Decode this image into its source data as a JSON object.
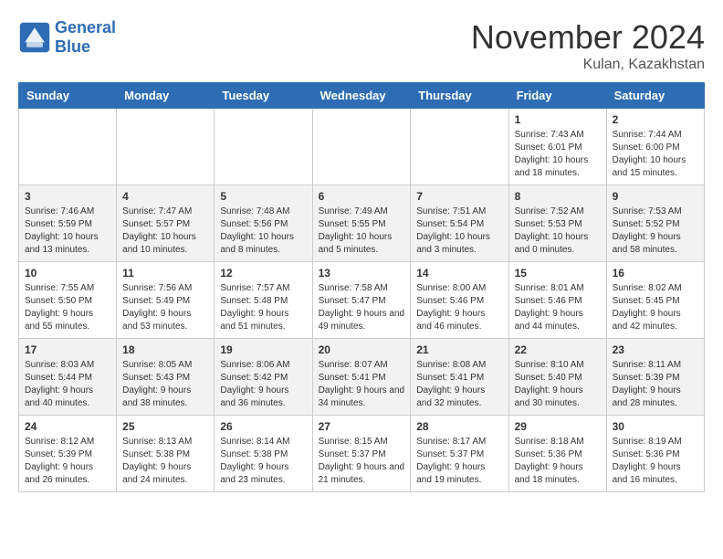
{
  "header": {
    "logo_line1": "General",
    "logo_line2": "Blue",
    "month_title": "November 2024",
    "location": "Kulan, Kazakhstan"
  },
  "weekdays": [
    "Sunday",
    "Monday",
    "Tuesday",
    "Wednesday",
    "Thursday",
    "Friday",
    "Saturday"
  ],
  "days": [
    {
      "num": "",
      "info": ""
    },
    {
      "num": "",
      "info": ""
    },
    {
      "num": "",
      "info": ""
    },
    {
      "num": "",
      "info": ""
    },
    {
      "num": "",
      "info": ""
    },
    {
      "num": "1",
      "info": "Sunrise: 7:43 AM\nSunset: 6:01 PM\nDaylight: 10 hours and 18 minutes."
    },
    {
      "num": "2",
      "info": "Sunrise: 7:44 AM\nSunset: 6:00 PM\nDaylight: 10 hours and 15 minutes."
    },
    {
      "num": "3",
      "info": "Sunrise: 7:46 AM\nSunset: 5:59 PM\nDaylight: 10 hours and 13 minutes."
    },
    {
      "num": "4",
      "info": "Sunrise: 7:47 AM\nSunset: 5:57 PM\nDaylight: 10 hours and 10 minutes."
    },
    {
      "num": "5",
      "info": "Sunrise: 7:48 AM\nSunset: 5:56 PM\nDaylight: 10 hours and 8 minutes."
    },
    {
      "num": "6",
      "info": "Sunrise: 7:49 AM\nSunset: 5:55 PM\nDaylight: 10 hours and 5 minutes."
    },
    {
      "num": "7",
      "info": "Sunrise: 7:51 AM\nSunset: 5:54 PM\nDaylight: 10 hours and 3 minutes."
    },
    {
      "num": "8",
      "info": "Sunrise: 7:52 AM\nSunset: 5:53 PM\nDaylight: 10 hours and 0 minutes."
    },
    {
      "num": "9",
      "info": "Sunrise: 7:53 AM\nSunset: 5:52 PM\nDaylight: 9 hours and 58 minutes."
    },
    {
      "num": "10",
      "info": "Sunrise: 7:55 AM\nSunset: 5:50 PM\nDaylight: 9 hours and 55 minutes."
    },
    {
      "num": "11",
      "info": "Sunrise: 7:56 AM\nSunset: 5:49 PM\nDaylight: 9 hours and 53 minutes."
    },
    {
      "num": "12",
      "info": "Sunrise: 7:57 AM\nSunset: 5:48 PM\nDaylight: 9 hours and 51 minutes."
    },
    {
      "num": "13",
      "info": "Sunrise: 7:58 AM\nSunset: 5:47 PM\nDaylight: 9 hours and 49 minutes."
    },
    {
      "num": "14",
      "info": "Sunrise: 8:00 AM\nSunset: 5:46 PM\nDaylight: 9 hours and 46 minutes."
    },
    {
      "num": "15",
      "info": "Sunrise: 8:01 AM\nSunset: 5:46 PM\nDaylight: 9 hours and 44 minutes."
    },
    {
      "num": "16",
      "info": "Sunrise: 8:02 AM\nSunset: 5:45 PM\nDaylight: 9 hours and 42 minutes."
    },
    {
      "num": "17",
      "info": "Sunrise: 8:03 AM\nSunset: 5:44 PM\nDaylight: 9 hours and 40 minutes."
    },
    {
      "num": "18",
      "info": "Sunrise: 8:05 AM\nSunset: 5:43 PM\nDaylight: 9 hours and 38 minutes."
    },
    {
      "num": "19",
      "info": "Sunrise: 8:06 AM\nSunset: 5:42 PM\nDaylight: 9 hours and 36 minutes."
    },
    {
      "num": "20",
      "info": "Sunrise: 8:07 AM\nSunset: 5:41 PM\nDaylight: 9 hours and 34 minutes."
    },
    {
      "num": "21",
      "info": "Sunrise: 8:08 AM\nSunset: 5:41 PM\nDaylight: 9 hours and 32 minutes."
    },
    {
      "num": "22",
      "info": "Sunrise: 8:10 AM\nSunset: 5:40 PM\nDaylight: 9 hours and 30 minutes."
    },
    {
      "num": "23",
      "info": "Sunrise: 8:11 AM\nSunset: 5:39 PM\nDaylight: 9 hours and 28 minutes."
    },
    {
      "num": "24",
      "info": "Sunrise: 8:12 AM\nSunset: 5:39 PM\nDaylight: 9 hours and 26 minutes."
    },
    {
      "num": "25",
      "info": "Sunrise: 8:13 AM\nSunset: 5:38 PM\nDaylight: 9 hours and 24 minutes."
    },
    {
      "num": "26",
      "info": "Sunrise: 8:14 AM\nSunset: 5:38 PM\nDaylight: 9 hours and 23 minutes."
    },
    {
      "num": "27",
      "info": "Sunrise: 8:15 AM\nSunset: 5:37 PM\nDaylight: 9 hours and 21 minutes."
    },
    {
      "num": "28",
      "info": "Sunrise: 8:17 AM\nSunset: 5:37 PM\nDaylight: 9 hours and 19 minutes."
    },
    {
      "num": "29",
      "info": "Sunrise: 8:18 AM\nSunset: 5:36 PM\nDaylight: 9 hours and 18 minutes."
    },
    {
      "num": "30",
      "info": "Sunrise: 8:19 AM\nSunset: 5:36 PM\nDaylight: 9 hours and 16 minutes."
    }
  ]
}
